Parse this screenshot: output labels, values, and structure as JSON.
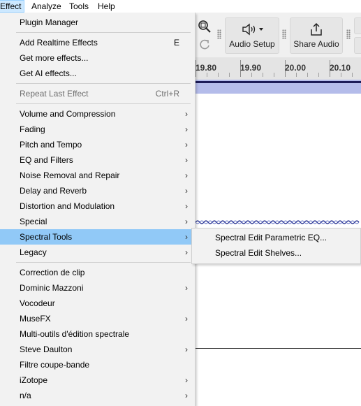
{
  "menubar": {
    "items": [
      {
        "label": "Effect",
        "open": true
      },
      {
        "label": "Analyze"
      },
      {
        "label": "Tools"
      },
      {
        "label": "Help"
      }
    ]
  },
  "toolbar": {
    "audio_setup_label": "Audio Setup",
    "share_audio_label": "Share Audio",
    "icons": [
      "zoom-toggle-icon",
      "redo-icon",
      "speaker-icon",
      "share-icon"
    ]
  },
  "ruler": {
    "ticks": [
      "19.80",
      "19.90",
      "20.00",
      "20.10"
    ]
  },
  "effect_menu": {
    "items": [
      {
        "label": "Plugin Manager"
      },
      {
        "label": "Add Realtime Effects",
        "accel": "E"
      },
      {
        "label": "Get more effects..."
      },
      {
        "label": "Get AI effects..."
      },
      {
        "label": "Repeat Last Effect",
        "accel": "Ctrl+R",
        "disabled": true
      },
      {
        "label": "Volume and Compression",
        "submenu": true
      },
      {
        "label": "Fading",
        "submenu": true
      },
      {
        "label": "Pitch and Tempo",
        "submenu": true
      },
      {
        "label": "EQ and Filters",
        "submenu": true
      },
      {
        "label": "Noise Removal and Repair",
        "submenu": true
      },
      {
        "label": "Delay and Reverb",
        "submenu": true
      },
      {
        "label": "Distortion and Modulation",
        "submenu": true
      },
      {
        "label": "Special",
        "submenu": true
      },
      {
        "label": "Spectral Tools",
        "submenu": true,
        "highlighted": true
      },
      {
        "label": "Legacy",
        "submenu": true
      },
      {
        "label": "Correction de clip"
      },
      {
        "label": "Dominic Mazzoni",
        "submenu": true
      },
      {
        "label": "Vocodeur"
      },
      {
        "label": "MuseFX",
        "submenu": true
      },
      {
        "label": "Multi-outils d'édition spectrale"
      },
      {
        "label": "Steve Daulton",
        "submenu": true
      },
      {
        "label": "Filtre coupe-bande"
      },
      {
        "label": "iZotope",
        "submenu": true
      },
      {
        "label": "n/a",
        "submenu": true
      }
    ],
    "submenu_arrow": "›"
  },
  "spectral_submenu": {
    "items": [
      {
        "label": "Spectral Edit Parametric EQ..."
      },
      {
        "label": "Spectral Edit Shelves..."
      }
    ]
  },
  "colors": {
    "menu_bg": "#f2f2f2",
    "highlight": "#91c9f7",
    "selection": "#b4bcea"
  }
}
